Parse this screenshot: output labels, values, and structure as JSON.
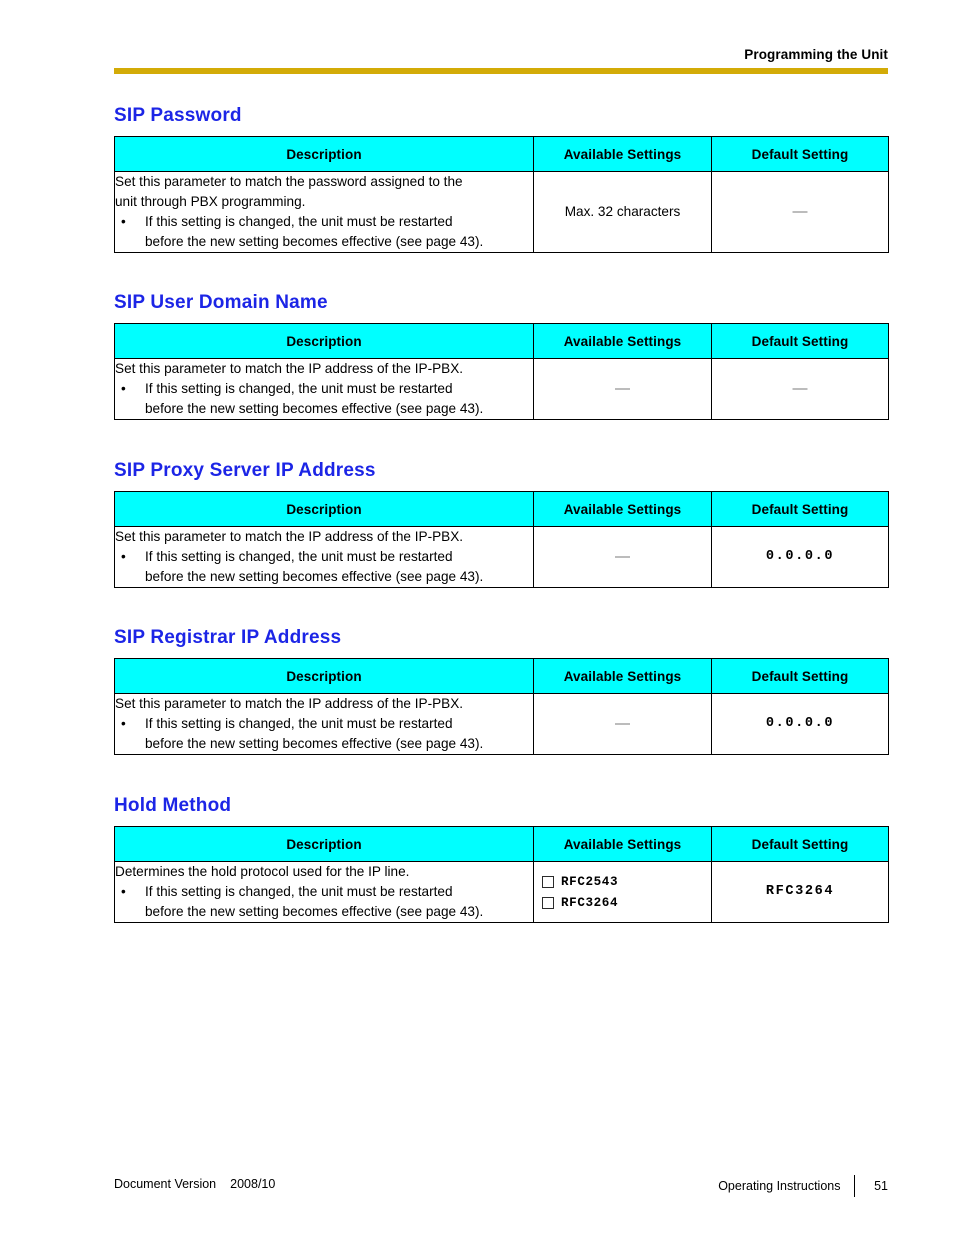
{
  "header": {
    "running_title": "Programming the Unit",
    "rule_color": "#d3ab07"
  },
  "theme": {
    "heading_color": "#1c25e6",
    "table_header_bg": "#00ffff",
    "dash_color": "#7a7a7a"
  },
  "table_headers": {
    "description": "Description",
    "available_settings": "Available Settings",
    "default_setting": "Default Setting"
  },
  "common": {
    "bullet": "•",
    "restart_note_line1": "If this setting is changed, the unit must be restarted",
    "restart_note_line2": "before the new setting becomes effective (see page 43).",
    "dash": "—"
  },
  "sections": [
    {
      "title": "SIP Password",
      "description_lead_line1": "Set this parameter to match the password assigned to the",
      "description_lead_line2": "unit through PBX programming.",
      "bullet_line1": "If this setting is changed, the unit must be restarted",
      "bullet_line2": "before the new setting becomes effective (see page 43).",
      "available": "Max. 32 characters",
      "default": "—"
    },
    {
      "title": "SIP User Domain Name",
      "description_lead_line1": "Set this parameter to match the IP address of the IP-PBX.",
      "description_lead_line2": "",
      "bullet_line1": "If this setting is changed, the unit must be restarted",
      "bullet_line2": "before the new setting becomes effective (see page 43).",
      "available": "—",
      "default": "—"
    },
    {
      "title": "SIP Proxy Server IP Address",
      "description_lead_line1": "Set this parameter to match the IP address of the IP-PBX.",
      "description_lead_line2": "",
      "bullet_line1": "If this setting is changed, the unit must be restarted",
      "bullet_line2": "before the new setting becomes effective (see page 43).",
      "available": "—",
      "default": "0.0.0.0"
    },
    {
      "title": "SIP Registrar IP Address",
      "description_lead_line1": "Set this parameter to match the IP address of the IP-PBX.",
      "description_lead_line2": "",
      "bullet_line1": "If this setting is changed, the unit must be restarted",
      "bullet_line2": "before the new setting becomes effective (see page 43).",
      "available": "—",
      "default": "0.0.0.0"
    },
    {
      "title": "Hold Method",
      "description_lead_line1": "Determines the hold protocol used for the IP line.",
      "description_lead_line2": "",
      "bullet_line1": "If this setting is changed, the unit must be restarted",
      "bullet_line2": "before the new setting becomes effective (see page 43).",
      "options": [
        {
          "label": "RFC2543",
          "checked": false
        },
        {
          "label": "RFC3264",
          "checked": false
        }
      ],
      "default": "RFC3264"
    }
  ],
  "footer": {
    "doc_version_label": "Document Version",
    "doc_version_value": "2008/10",
    "manual_title": "Operating Instructions",
    "page_number": "51"
  }
}
